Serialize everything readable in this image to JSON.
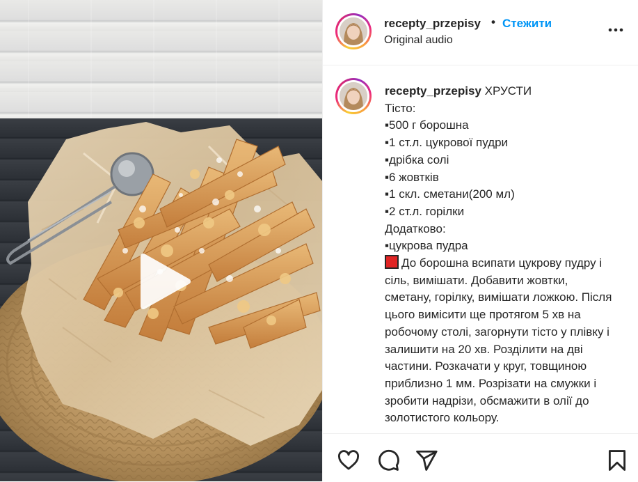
{
  "post": {
    "username": "recepty_przepisy",
    "separator": "•",
    "follow_label": "Стежити",
    "audio_label": "Original audio"
  },
  "caption": {
    "username": "recepty_przepisy",
    "title": "ХРУСТИ",
    "lines": [
      "Тісто:",
      "▪500 г борошна",
      "▪1 ст.л. цукрової пудри",
      "▪дрібка солі",
      "▪6 жовтків",
      "▪1 скл. сметани(200 мл)",
      "▪2 ст.л. горілки",
      "Додатково:",
      "▪цукрова пудра"
    ],
    "paragraph": "До борошна всипати цукрову пудру і сіль, вимішати. Добавити жовтки, сметану, горілку, вимішати ложкою. Після цього вимісити ще протягом 5 хв на робочому столі, загорнути тісто у плівку і залишити на 20 хв. Розділити на дві частини. Розкачати у круг, товщиною приблизно 1 мм. Розрізати на смужки і зробити надрізи, обсмажити в олії до золотистого кольору."
  },
  "icons": {
    "more": "more-horizontal-icon",
    "play": "play-icon",
    "like": "heart-icon",
    "comment": "comment-icon",
    "share": "send-icon",
    "save": "bookmark-icon"
  },
  "colors": {
    "follow": "#0095f6",
    "text": "#262626",
    "divider": "#efefef"
  }
}
